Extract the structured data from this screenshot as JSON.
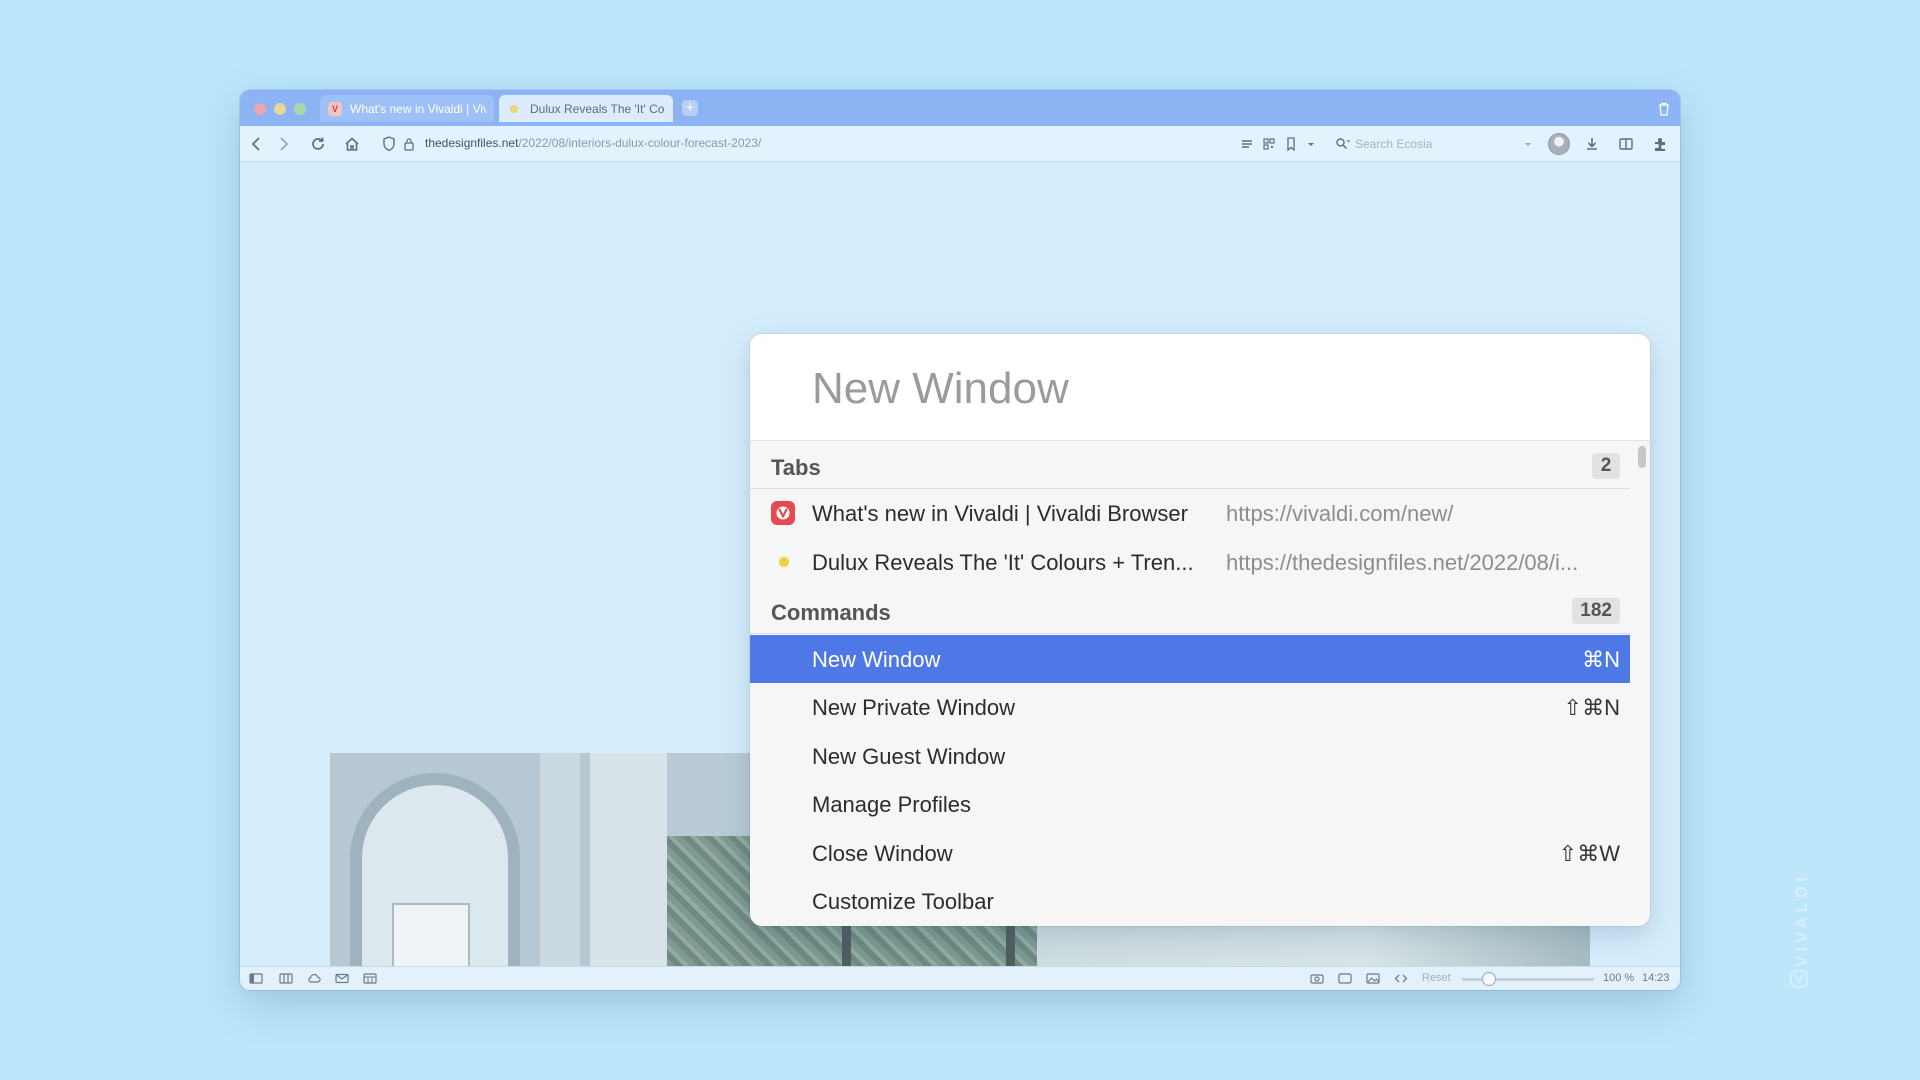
{
  "browser": {
    "tabs": [
      {
        "title": "What's new in Vivaldi | Viv",
        "favicon": "vivaldi-icon"
      },
      {
        "title": "Dulux Reveals The 'It' Colo",
        "favicon": "yellow-dot-icon"
      }
    ],
    "new_tab_label": "+",
    "address": {
      "domain": "thedesignfiles.net",
      "path": "/2022/08/interiors-dulux-colour-forecast-2023/"
    },
    "search_placeholder": "Search Ecosia"
  },
  "status_bar": {
    "reset_label": "Reset",
    "zoom": "100 %",
    "clock": "14:23"
  },
  "palette": {
    "query": "New Window",
    "sections": {
      "tabs": {
        "title": "Tabs",
        "count": "2"
      },
      "commands": {
        "title": "Commands",
        "count": "182"
      }
    },
    "tab_results": [
      {
        "title": "What's new in Vivaldi | Vivaldi Browser",
        "url": "https://vivaldi.com/new/"
      },
      {
        "title": "Dulux Reveals The 'It' Colours + Tren...",
        "url": "https://thedesignfiles.net/2022/08/i..."
      }
    ],
    "command_results": [
      {
        "label": "New Window",
        "shortcut": "⌘N",
        "selected": true
      },
      {
        "label": "New Private Window",
        "shortcut": "⇧⌘N"
      },
      {
        "label": "New Guest Window",
        "shortcut": ""
      },
      {
        "label": "Manage Profiles",
        "shortcut": ""
      },
      {
        "label": "Close Window",
        "shortcut": "⇧⌘W"
      },
      {
        "label": "Customize Toolbar",
        "shortcut": ""
      }
    ]
  },
  "watermark": "VIVALDI",
  "colors": {
    "accent": "#4d78e6",
    "vivaldi_red": "#e64a4f",
    "dot_yellow": "#f0cf38",
    "desktop": "#bde6fb"
  }
}
